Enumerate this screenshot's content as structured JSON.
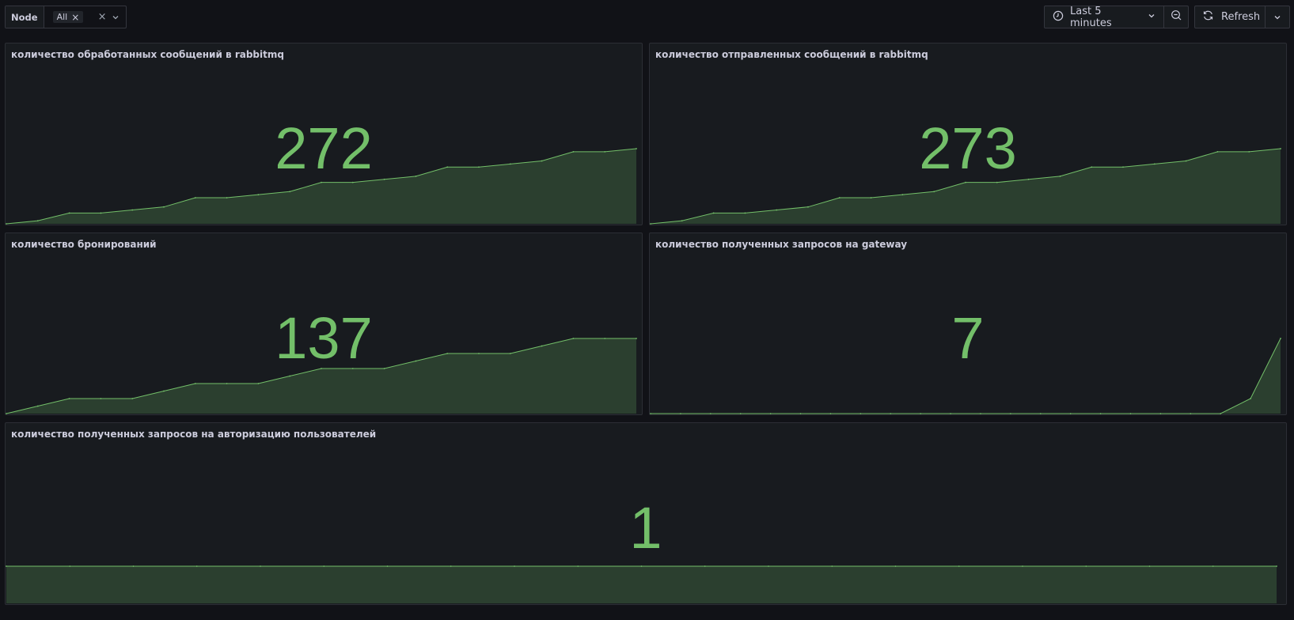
{
  "variable": {
    "label": "Node",
    "chip": "All"
  },
  "time_picker": {
    "label": "Last 5 minutes"
  },
  "refresh": {
    "label": "Refresh"
  },
  "colors": {
    "accent": "#73bf69",
    "fill": "#73bf69"
  },
  "panels": [
    {
      "title": "количество обработанных сообщений в rabbitmq",
      "value": "272",
      "series": [
        0,
        2,
        7,
        7,
        9,
        11,
        17,
        17,
        19,
        21,
        27,
        27,
        29,
        31,
        37,
        37,
        39,
        41,
        47,
        47,
        49
      ]
    },
    {
      "title": "количество отправленных сообщений в rabbitmq",
      "value": "273",
      "series": [
        0,
        2,
        7,
        7,
        9,
        11,
        17,
        17,
        19,
        21,
        27,
        27,
        29,
        31,
        37,
        37,
        39,
        41,
        47,
        47,
        49
      ]
    },
    {
      "title": "количество бронирований",
      "value": "137",
      "series": [
        0,
        4,
        8,
        8,
        8,
        12,
        16,
        16,
        16,
        20,
        24,
        24,
        24,
        28,
        32,
        32,
        32,
        36,
        40,
        40,
        40
      ]
    },
    {
      "title": "количество полученных запросов на gateway",
      "value": "7",
      "series": [
        0,
        0,
        0,
        0,
        0,
        0,
        0,
        0,
        0,
        0,
        0,
        0,
        0,
        0,
        0,
        0,
        0,
        0,
        0,
        0,
        1,
        5
      ]
    },
    {
      "title": "количество полученных запросов на авторизацию пользователей",
      "value": "1",
      "series": [
        1,
        1,
        1,
        1,
        1,
        1,
        1,
        1,
        1,
        1,
        1,
        1,
        1,
        1,
        1,
        1,
        1,
        1,
        1,
        1,
        1
      ]
    }
  ]
}
